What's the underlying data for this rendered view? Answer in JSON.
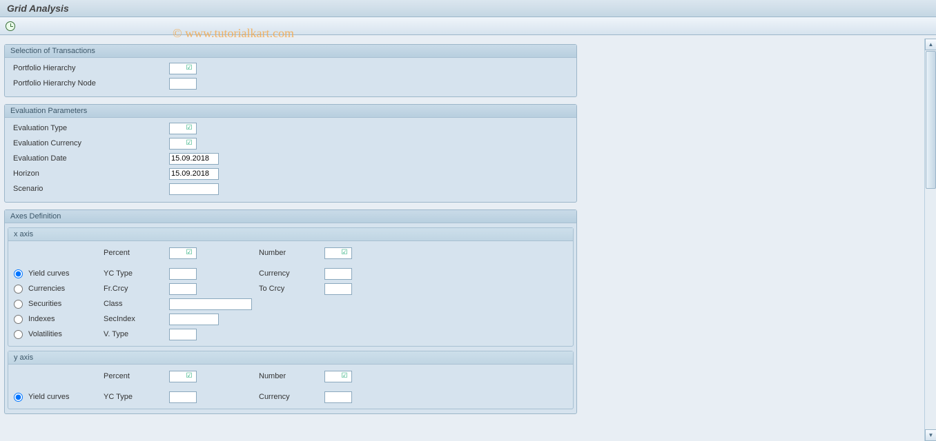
{
  "title": "Grid Analysis",
  "watermark": "© www.tutorialkart.com",
  "groups": {
    "selection": {
      "title": "Selection of Transactions",
      "portfolio_hierarchy_label": "Portfolio Hierarchy",
      "portfolio_hierarchy_node_label": "Portfolio Hierarchy Node"
    },
    "evaluation": {
      "title": "Evaluation Parameters",
      "eval_type_label": "Evaluation Type",
      "eval_currency_label": "Evaluation Currency",
      "eval_date_label": "Evaluation Date",
      "eval_date_value": "15.09.2018",
      "horizon_label": "Horizon",
      "horizon_value": "15.09.2018",
      "scenario_label": "Scenario"
    },
    "axes": {
      "title": "Axes Definition",
      "x_axis_title": "x axis",
      "y_axis_title": "y axis",
      "percent_label": "Percent",
      "number_label": "Number",
      "radio_yield_curves": "Yield curves",
      "radio_currencies": "Currencies",
      "radio_securities": "Securities",
      "radio_indexes": "Indexes",
      "radio_volatilities": "Volatilities",
      "yc_type_label": "YC Type",
      "currency_label": "Currency",
      "fr_crcy_label": "Fr.Crcy",
      "to_crcy_label": "To Crcy",
      "class_label": "Class",
      "secindex_label": "SecIndex",
      "v_type_label": "V. Type"
    }
  },
  "checkmark": "☑",
  "scroll": {
    "up": "▲",
    "down": "▼"
  }
}
